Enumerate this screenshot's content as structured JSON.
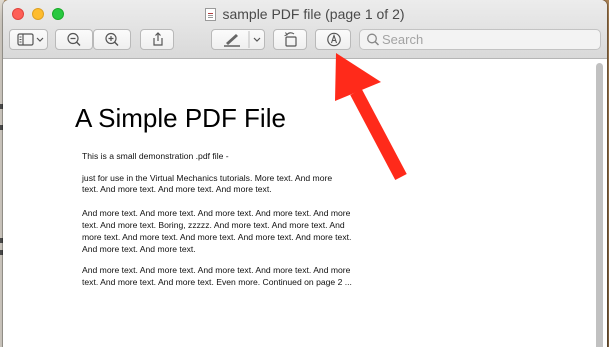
{
  "window": {
    "title": "sample PDF file (page 1 of 2)",
    "controls": [
      "close",
      "minimize",
      "zoom"
    ]
  },
  "toolbar": {
    "buttons": [
      {
        "name": "sidebar-toggle-button",
        "icon": "sidebar-icon",
        "has_dropdown": true
      },
      {
        "name": "zoom-out-button",
        "icon": "zoom-out-icon"
      },
      {
        "name": "zoom-in-button",
        "icon": "zoom-in-icon"
      },
      {
        "name": "share-button",
        "icon": "share-icon"
      },
      {
        "name": "highlight-button",
        "icon": "pen-icon",
        "has_dropdown": true
      },
      {
        "name": "rotate-button",
        "icon": "rotate-icon"
      },
      {
        "name": "markup-button",
        "icon": "markup-pen-icon"
      }
    ],
    "search": {
      "placeholder": "Search",
      "value": "",
      "icon": "search-icon"
    }
  },
  "document": {
    "title": "A Simple PDF File",
    "lines": [
      "This is a small demonstration .pdf file -",
      "just for use in the Virtual Mechanics tutorials. More text. And more",
      "text. And more text. And more text. And more text.",
      "And more text. And more text. And more text. And more text. And more",
      "text. And more text. Boring, zzzzz. And more text. And more text. And",
      "more text. And more text. And more text. And more text. And more text.",
      "And more text. And more text.",
      "And more text. And more text. And more text. And more text. And more",
      "text. And more text. And more text. Even more. Continued on page 2 ..."
    ]
  },
  "annotation": {
    "type": "arrow",
    "color": "#ff2a1a",
    "points_to": "markup-button"
  },
  "colors": {
    "close": "#fe5f57",
    "minimize": "#febc2e",
    "zoom": "#28c840"
  }
}
